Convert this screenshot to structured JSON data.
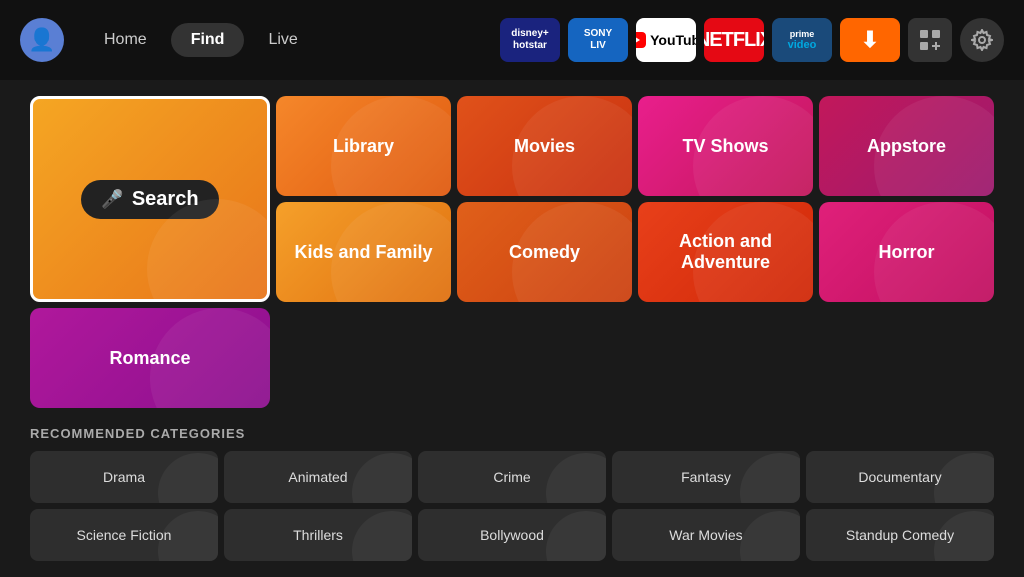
{
  "header": {
    "nav": [
      {
        "id": "home",
        "label": "Home",
        "active": false
      },
      {
        "id": "find",
        "label": "Find",
        "active": true
      },
      {
        "id": "live",
        "label": "Live",
        "active": false
      }
    ],
    "apps": [
      {
        "id": "hotstar",
        "label": "disney+ hotstar"
      },
      {
        "id": "sonyliv",
        "label": "SONY LIV"
      },
      {
        "id": "youtube",
        "label": "YouTube"
      },
      {
        "id": "netflix",
        "label": "NETFLIX"
      },
      {
        "id": "prime",
        "label": "prime video"
      },
      {
        "id": "downloader",
        "label": "Downloader"
      },
      {
        "id": "appgrid",
        "label": "App Grid"
      },
      {
        "id": "settings",
        "label": "Settings"
      }
    ]
  },
  "categories": {
    "main": [
      {
        "id": "search",
        "label": "Search"
      },
      {
        "id": "library",
        "label": "Library"
      },
      {
        "id": "movies",
        "label": "Movies"
      },
      {
        "id": "tvshows",
        "label": "TV Shows"
      },
      {
        "id": "appstore",
        "label": "Appstore"
      },
      {
        "id": "kids",
        "label": "Kids and Family"
      },
      {
        "id": "comedy",
        "label": "Comedy"
      },
      {
        "id": "action",
        "label": "Action and Adventure"
      },
      {
        "id": "horror",
        "label": "Horror"
      },
      {
        "id": "romance",
        "label": "Romance"
      }
    ],
    "recommended_label": "RECOMMENDED CATEGORIES",
    "recommended": [
      {
        "id": "drama",
        "label": "Drama"
      },
      {
        "id": "animated",
        "label": "Animated"
      },
      {
        "id": "crime",
        "label": "Crime"
      },
      {
        "id": "fantasy",
        "label": "Fantasy"
      },
      {
        "id": "documentary",
        "label": "Documentary"
      },
      {
        "id": "scifi",
        "label": "Science Fiction"
      },
      {
        "id": "thrillers",
        "label": "Thrillers"
      },
      {
        "id": "bollywood",
        "label": "Bollywood"
      },
      {
        "id": "warmovies",
        "label": "War Movies"
      },
      {
        "id": "standup",
        "label": "Standup Comedy"
      }
    ]
  }
}
